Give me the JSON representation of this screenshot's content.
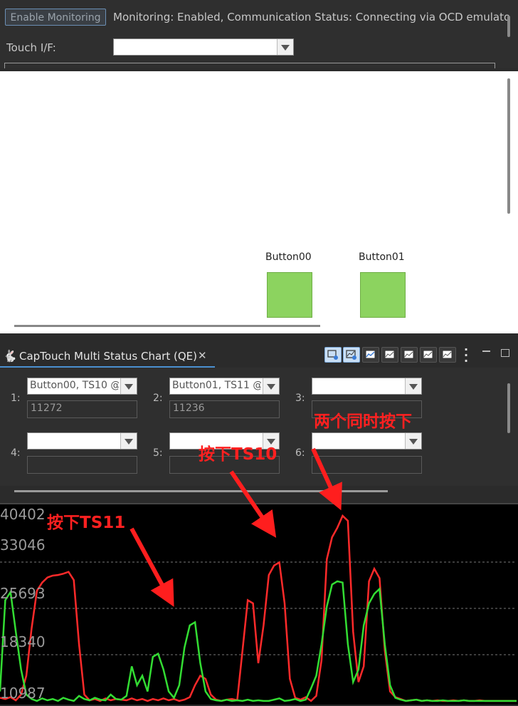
{
  "monitor": {
    "enable_label": "Enable Monitoring",
    "status_text": "Monitoring: Enabled, Communication Status: Connecting via OCD emulato",
    "touch_if_label": "Touch I/F:",
    "touch_if_value": ""
  },
  "canvas": {
    "buttons": [
      {
        "label": "Button00",
        "color": "#8cd35f"
      },
      {
        "label": "Button01",
        "color": "#8cd35f"
      }
    ]
  },
  "view": {
    "title": "CapTouch Multi Status Chart (QE)",
    "close_icon": "close-icon",
    "tab_icon": "rabbit-icon",
    "toolbar": [
      "chart-settings-icon",
      "chart-auto-icon",
      "chart-scale-icon",
      "chart-zoom-icon",
      "chart-fit-icon",
      "chart-check-icon",
      "chart-export-icon",
      "more-icon",
      "minimize-icon",
      "maximize-icon"
    ]
  },
  "selectors": [
    {
      "num": "1:",
      "combo": "Button00, TS10 @",
      "value": "11272"
    },
    {
      "num": "2:",
      "combo": "Button01, TS11 @",
      "value": "11236"
    },
    {
      "num": "3:",
      "combo": "",
      "value": ""
    },
    {
      "num": "4:",
      "combo": "",
      "value": ""
    },
    {
      "num": "5:",
      "combo": "",
      "value": ""
    },
    {
      "num": "6:",
      "combo": "",
      "value": ""
    }
  ],
  "annotations": {
    "ts11": "按下TS11",
    "ts10": "按下TS10",
    "both": "两个同时按下"
  },
  "chart_data": {
    "type": "line",
    "y_ticks": [
      "40402",
      "33046",
      "25693",
      "18340",
      "10987"
    ],
    "ylim": [
      10987,
      40402
    ],
    "grid": "dashed horizontal",
    "series": [
      {
        "color": "#ff2a2a",
        "values": [
          11500,
          11300,
          11600,
          11100,
          12000,
          15000,
          22500,
          28500,
          29800,
          30600,
          30900,
          31000,
          31200,
          31500,
          30200,
          20000,
          12000,
          11100,
          11300,
          11000,
          11400,
          11100,
          11300,
          11200,
          11100,
          11400,
          11100,
          11300,
          11000,
          11300,
          11100,
          11400,
          11100,
          11300,
          11000,
          11200,
          11600,
          13500,
          15000,
          14500,
          12000,
          11200,
          11000,
          11200,
          11300,
          11100,
          19000,
          27000,
          26500,
          17000,
          23000,
          31000,
          32500,
          33000,
          26500,
          14500,
          11500,
          11200,
          11600,
          11000,
          11800,
          17500,
          33500,
          37000,
          38500,
          40400,
          39600,
          22000,
          14000,
          16500,
          30000,
          32000,
          30500,
          19000,
          12500,
          11600,
          11300,
          11000,
          11100,
          11200,
          11000,
          11100,
          11000,
          11100,
          11000,
          11000,
          11100,
          11000,
          11100,
          11000,
          11000,
          11100,
          11000,
          11000,
          11000,
          11000,
          11000,
          11000,
          11000
        ]
      },
      {
        "color": "#33dd33",
        "values": [
          12500,
          27000,
          28300,
          22000,
          16000,
          12000,
          11300,
          11000,
          11400,
          11100,
          11300,
          11000,
          11500,
          11200,
          11000,
          11800,
          11300,
          11100,
          11500,
          11200,
          11100,
          12000,
          11300,
          11200,
          11800,
          16500,
          13500,
          15000,
          12500,
          18000,
          18500,
          16000,
          12500,
          11500,
          13500,
          19500,
          23000,
          23500,
          17000,
          12500,
          11300,
          11100,
          11000,
          11200,
          11000,
          11100,
          11000,
          11200,
          11000,
          11100,
          11000,
          11000,
          11200,
          11400,
          11000,
          11100,
          11300,
          11000,
          11200,
          13000,
          15000,
          20000,
          26000,
          29500,
          30000,
          29800,
          20000,
          14000,
          16000,
          23000,
          26500,
          28000,
          28800,
          20000,
          13500,
          11500,
          11200,
          11000,
          11100,
          11200,
          11000,
          11100,
          11000,
          11000,
          11100,
          11000,
          11000,
          11000,
          11100,
          11000,
          11000,
          11000,
          11000,
          11000,
          11000,
          11000,
          11000,
          11000,
          11000
        ]
      }
    ]
  }
}
